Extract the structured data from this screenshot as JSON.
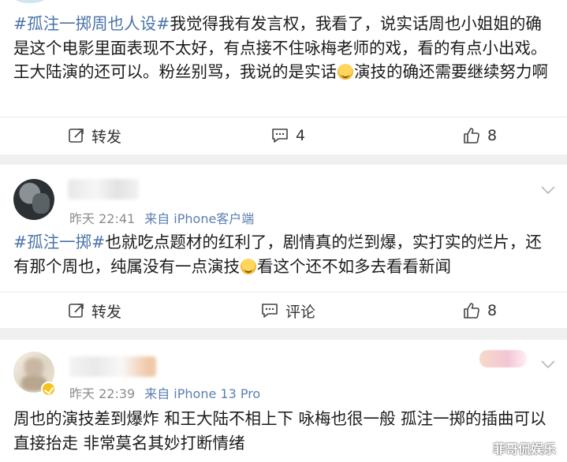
{
  "posts": [
    {
      "text_parts": [
        "#孤注一掷周也人设#",
        "我觉得我有发言权，我看了，说实话周也小姐姐的确是这个电影里面表现不太好，有点接不住咏梅老师的戏，看的有点小出戏。王大陆演的还可以。粉丝别骂，我说的是实话",
        "演技的确还需要继续努力啊"
      ],
      "actions": {
        "repost": "转发",
        "comment": "4",
        "like": "8"
      }
    },
    {
      "meta": {
        "time": "昨天 22:41",
        "source": "来自 iPhone客户端"
      },
      "text_parts": [
        "#孤注一掷#",
        "也就吃点题材的红利了，剧情真的烂到爆，实打实的烂片，还有那个周也，纯属没有一点演技",
        "看这个还不如多去看看新闻"
      ],
      "actions": {
        "repost": "转发",
        "comment": "评论",
        "like": "8"
      }
    },
    {
      "meta": {
        "time": "昨天 22:39",
        "source": "来自 iPhone 13 Pro"
      },
      "text": "周也的演技差到爆炸 和王大陆不相上下 咏梅也很一般 孤注一掷的插曲可以直接抬走 非常莫名其妙打断情绪"
    }
  ],
  "watermark": "菲哥侃娱乐",
  "colors": {
    "hashtag": "#4a73a8",
    "meta": "#8c8c8c",
    "background": "#f0f0f0"
  },
  "icons": [
    "repost-icon",
    "comment-icon",
    "like-icon",
    "chevron-down-icon",
    "emoji-icon",
    "verified-badge-icon"
  ]
}
